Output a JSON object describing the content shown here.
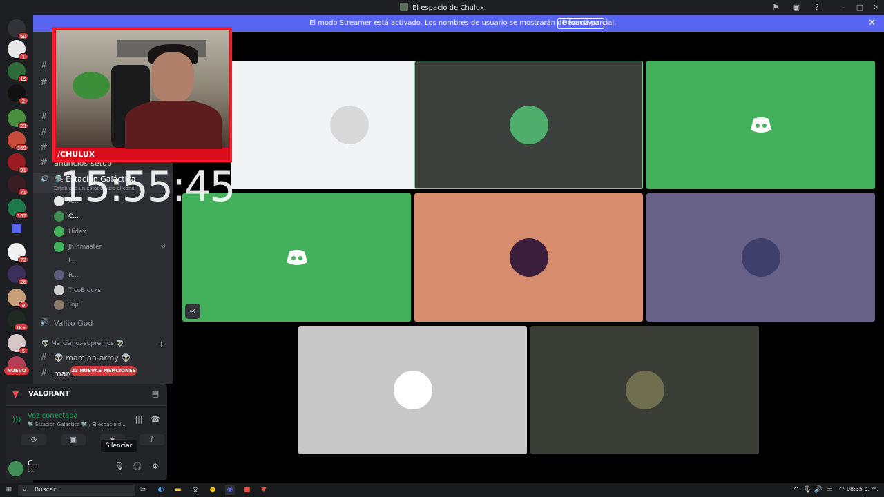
{
  "window": {
    "title": "El espacio de Chulux"
  },
  "banner": {
    "message": "El modo Streamer está activado. Los nombres de usuario se mostrarán de forma parcial.",
    "button_label": "Desactivar",
    "close_icon": "close-icon",
    "color": "#5865f2"
  },
  "servers": {
    "badges": [
      "60",
      "1",
      "15",
      "2",
      "23",
      "369",
      "91",
      "71",
      "107",
      "72",
      "26",
      "9",
      "1K+",
      "5"
    ],
    "nuevo_label": "NUEVO"
  },
  "channels": {
    "text_partial": "anuncios-setup",
    "voice_channel": "🛸 Estación Galáctica",
    "voice_status": "Establece un estado para el canal",
    "voice_users": [
      "A...",
      "C...",
      "Hidex",
      "Jhinmaster",
      "L...",
      "R...",
      "TicoBlocks",
      "Toji"
    ],
    "other_voice": "Valito God",
    "category": "👽 Marciano.-supremos 👽",
    "marcian_army": "👽 marcian-army 👽",
    "marci_partial": "marci",
    "mentions_pill": "23 NUEVAS MENCIONES"
  },
  "panel": {
    "game": "VALORANT",
    "voice_connected": "Voz conectada",
    "voice_location": "🛸 Estación Galáctica 🛸 / El espacio d...",
    "tooltip": "Silenciar",
    "user_name": "C...",
    "user_status": "C..."
  },
  "stage": {
    "tiles": [
      {
        "bg": "#f2f3f5",
        "type": "avatar",
        "avatar_color": "#d8d8d8"
      },
      {
        "bg": "#3b403d",
        "type": "avatar",
        "avatar_color": "#4fae6b",
        "border": "#7bc58a"
      },
      {
        "bg": "#43b05b",
        "type": "discord"
      },
      {
        "bg": "#43b05b",
        "type": "discord",
        "muted": true
      },
      {
        "bg": "#d88c6e",
        "type": "avatar",
        "avatar_color": "#3a1e3c"
      },
      {
        "bg": "#686188",
        "type": "avatar",
        "avatar_color": "#3f3f6b"
      },
      {
        "bg": "#c7c7c7",
        "type": "avatar",
        "avatar_color": "#ffffff"
      },
      {
        "bg": "#3a3d36",
        "type": "avatar",
        "avatar_color": "#6f6f50"
      }
    ]
  },
  "overlay": {
    "streamer_tag": "/CHULUX",
    "clock": "15:55:45"
  },
  "taskbar": {
    "search_placeholder": "Buscar",
    "time": "08:35 p. m."
  }
}
